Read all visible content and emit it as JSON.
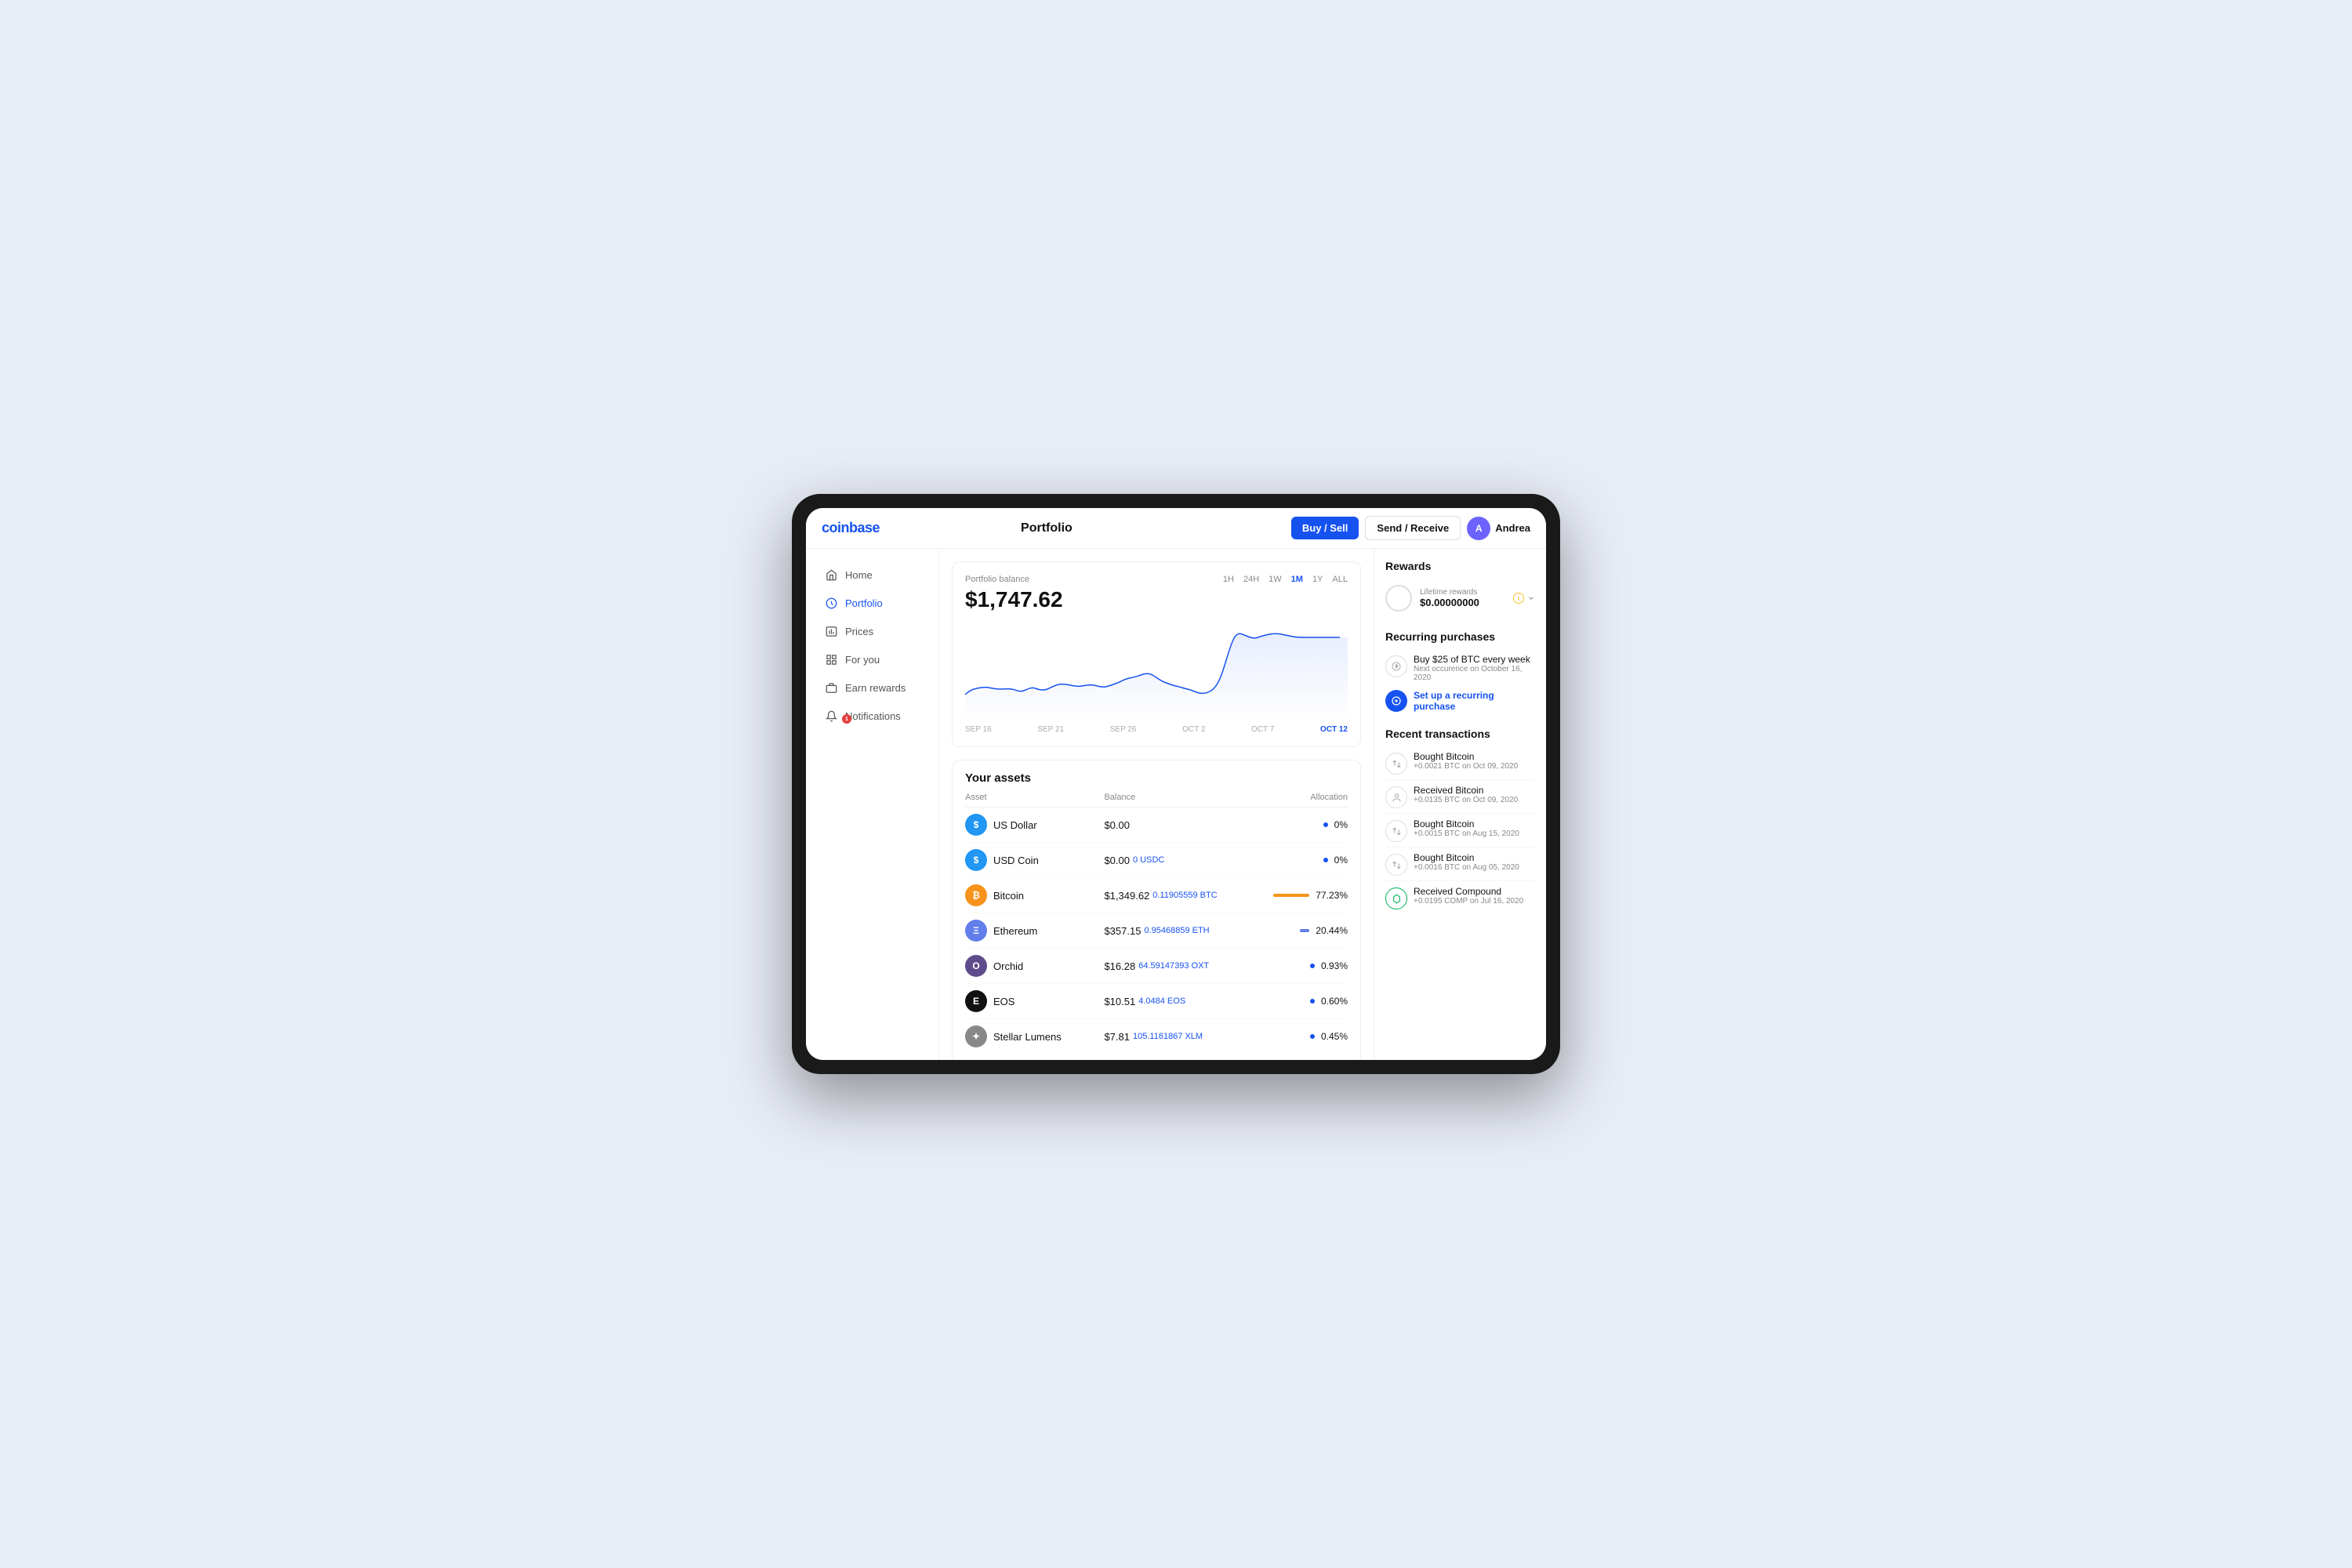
{
  "app": {
    "name": "coinbase",
    "page_title": "Portfolio",
    "buy_sell_label": "Buy / Sell",
    "send_receive_label": "Send / Receive",
    "user_name": "Andrea"
  },
  "sidebar": {
    "items": [
      {
        "id": "home",
        "label": "Home",
        "icon": "home",
        "active": false
      },
      {
        "id": "portfolio",
        "label": "Portfolio",
        "icon": "portfolio",
        "active": true
      },
      {
        "id": "prices",
        "label": "Prices",
        "icon": "prices",
        "active": false
      },
      {
        "id": "for-you",
        "label": "For you",
        "icon": "for-you",
        "active": false
      },
      {
        "id": "earn-rewards",
        "label": "Earn rewards",
        "icon": "earn-rewards",
        "active": false
      },
      {
        "id": "notifications",
        "label": "Notifications",
        "icon": "notifications",
        "active": false,
        "badge": "1"
      }
    ]
  },
  "portfolio": {
    "balance_label": "Portfolio balance",
    "balance_value": "$1,747.62",
    "timeframes": [
      "1H",
      "24H",
      "1W",
      "1M",
      "1Y",
      "ALL"
    ],
    "active_timeframe": "1M",
    "chart_labels": [
      "SEP 16",
      "SEP 21",
      "SEP 26",
      "OCT 2",
      "OCT 7",
      "OCT 12"
    ]
  },
  "assets": {
    "title": "Your assets",
    "columns": {
      "asset": "Asset",
      "balance": "Balance",
      "allocation": "Allocation"
    },
    "rows": [
      {
        "name": "US Dollar",
        "icon_bg": "#2196f3",
        "icon_text": "$",
        "balance_usd": "$0.00",
        "balance_crypto": "",
        "alloc_pct": "0%",
        "alloc_bar_width": 0,
        "alloc_bar_color": "#1652f0",
        "show_dot": true,
        "show_bar": false
      },
      {
        "name": "USD Coin",
        "icon_bg": "#2196f3",
        "icon_text": "$",
        "balance_usd": "$0.00",
        "balance_crypto": "0 USDC",
        "alloc_pct": "0%",
        "alloc_bar_width": 0,
        "alloc_bar_color": "#1652f0",
        "show_dot": true,
        "show_bar": false
      },
      {
        "name": "Bitcoin",
        "icon_bg": "#f7931a",
        "icon_text": "₿",
        "balance_usd": "$1,349.62",
        "balance_crypto": "0.11905559 BTC",
        "alloc_pct": "77.23%",
        "alloc_bar_width": 77,
        "alloc_bar_color": "#f7931a",
        "show_dot": false,
        "show_bar": true
      },
      {
        "name": "Ethereum",
        "icon_bg": "#627eea",
        "icon_text": "Ξ",
        "balance_usd": "$357.15",
        "balance_crypto": "0.95468859 ETH",
        "alloc_pct": "20.44%",
        "alloc_bar_width": 20,
        "alloc_bar_color": "#627eea",
        "show_dot": false,
        "show_bar": true
      },
      {
        "name": "Orchid",
        "icon_bg": "#5f4b8b",
        "icon_text": "O",
        "balance_usd": "$16.28",
        "balance_crypto": "64.59147393 OXT",
        "alloc_pct": "0.93%",
        "alloc_bar_width": 1,
        "alloc_bar_color": "#1652f0",
        "show_dot": true,
        "show_bar": false
      },
      {
        "name": "EOS",
        "icon_bg": "#111",
        "icon_text": "E",
        "balance_usd": "$10.51",
        "balance_crypto": "4.0484 EOS",
        "alloc_pct": "0.60%",
        "alloc_bar_width": 0,
        "alloc_bar_color": "#1652f0",
        "show_dot": true,
        "show_bar": false
      },
      {
        "name": "Stellar Lumens",
        "icon_bg": "#888",
        "icon_text": "✦",
        "balance_usd": "$7.81",
        "balance_crypto": "105.1161867 XLM",
        "alloc_pct": "0.45%",
        "alloc_bar_width": 0,
        "alloc_bar_color": "#1652f0",
        "show_dot": true,
        "show_bar": false
      }
    ]
  },
  "right_panel": {
    "rewards": {
      "title": "Rewards",
      "lifetime_label": "Lifetime rewards",
      "lifetime_value": "$0.00000000"
    },
    "recurring": {
      "title": "Recurring purchases",
      "items": [
        {
          "title": "Buy $25 of BTC every week",
          "sub": "Next occurence on October 16, 2020"
        }
      ],
      "setup_label": "Set up a recurring purchase"
    },
    "transactions": {
      "title": "Recent transactions",
      "items": [
        {
          "title": "Bought Bitcoin",
          "sub": "+0.0021 BTC on Oct 09, 2020",
          "icon_type": "exchange",
          "icon_color": "#ddd"
        },
        {
          "title": "Received Bitcoin",
          "sub": "+0.0135 BTC on Oct 09, 2020",
          "icon_type": "person",
          "icon_color": "#ddd"
        },
        {
          "title": "Bought Bitcoin",
          "sub": "+0.0015 BTC on Aug 15, 2020",
          "icon_type": "exchange",
          "icon_color": "#ddd"
        },
        {
          "title": "Bought Bitcoin",
          "sub": "+0.0016 BTC on Aug 05, 2020",
          "icon_type": "exchange",
          "icon_color": "#ddd"
        },
        {
          "title": "Received Compound",
          "sub": "+0.0195 COMP on Jul 16, 2020",
          "icon_type": "compound",
          "icon_color": "#00b25a"
        }
      ]
    }
  }
}
